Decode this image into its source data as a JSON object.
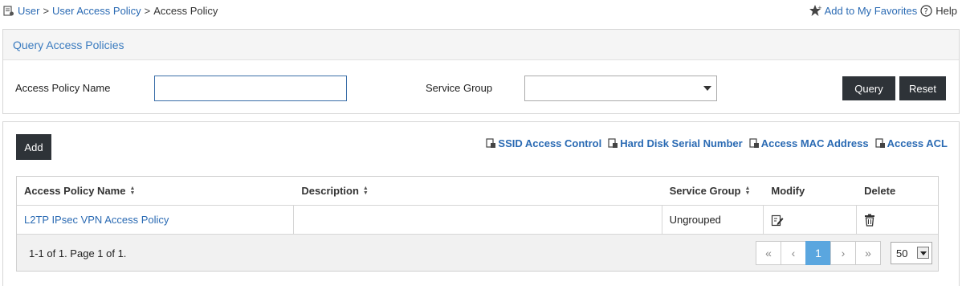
{
  "breadcrumb": {
    "items": [
      "User",
      "User Access Policy",
      "Access Policy"
    ],
    "separator": ">"
  },
  "top_actions": {
    "favorites": "Add to My Favorites",
    "help": "Help"
  },
  "query_panel": {
    "title": "Query Access Policies",
    "name_label": "Access Policy Name",
    "name_value": "",
    "group_label": "Service Group",
    "group_value": "",
    "query_button": "Query",
    "reset_button": "Reset"
  },
  "list_panel": {
    "add_button": "Add",
    "links": [
      "SSID Access Control",
      "Hard Disk Serial Number",
      "Access MAC Address",
      "Access ACL"
    ],
    "columns": [
      "Access Policy Name",
      "Description",
      "Service Group",
      "Modify",
      "Delete"
    ],
    "rows": [
      {
        "name": "L2TP IPsec VPN Access Policy",
        "description": "",
        "service_group": "Ungrouped"
      }
    ],
    "pager": {
      "info": "1-1 of 1. Page 1 of 1.",
      "first": "«",
      "prev": "‹",
      "current_page": "1",
      "next": "›",
      "last": "»",
      "page_size": "50"
    }
  },
  "colors": {
    "link": "#2a6ab3",
    "dark_button": "#2e3338",
    "active_page": "#5aa6df"
  }
}
